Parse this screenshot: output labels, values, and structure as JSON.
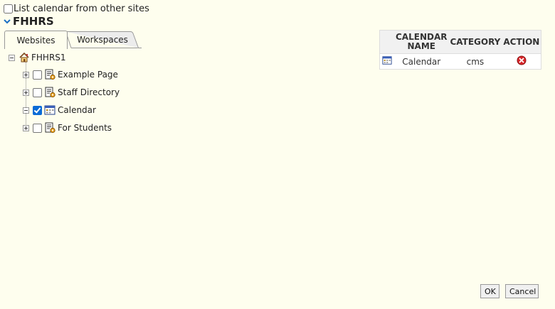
{
  "top_option": {
    "label": "List calendar from other sites",
    "checked": false
  },
  "site": {
    "title": "FHHRS"
  },
  "tabs": [
    {
      "label": "Websites",
      "active": true
    },
    {
      "label": "Workspaces",
      "active": false
    }
  ],
  "tree": {
    "root": {
      "label": "FHHRS1",
      "icon": "house-icon"
    },
    "children": [
      {
        "label": "Example Page",
        "checked": false,
        "icon": "page-icon"
      },
      {
        "label": "Staff Directory",
        "checked": false,
        "icon": "page-icon"
      },
      {
        "label": "Calendar",
        "checked": true,
        "icon": "calendar-icon"
      },
      {
        "label": "For Students",
        "checked": false,
        "icon": "page-icon"
      }
    ]
  },
  "calendar_table": {
    "headers": [
      "CALENDAR NAME",
      "CATEGORY",
      "ACTION"
    ],
    "header_lines": [
      [
        "CALENDAR",
        "NAME"
      ],
      [
        "CATEGORY"
      ],
      [
        "ACTION"
      ]
    ],
    "rows": [
      {
        "icon": "calendar-icon",
        "name": "Calendar",
        "category": "cms",
        "action_icon": "delete-icon"
      }
    ]
  },
  "buttons": {
    "ok": "OK",
    "cancel": "Cancel"
  },
  "colors": {
    "background": "#fefeee",
    "checkbox_checked": "#0b6bd6",
    "delete": "#d9262b",
    "chevron": "#1a6fc4"
  }
}
